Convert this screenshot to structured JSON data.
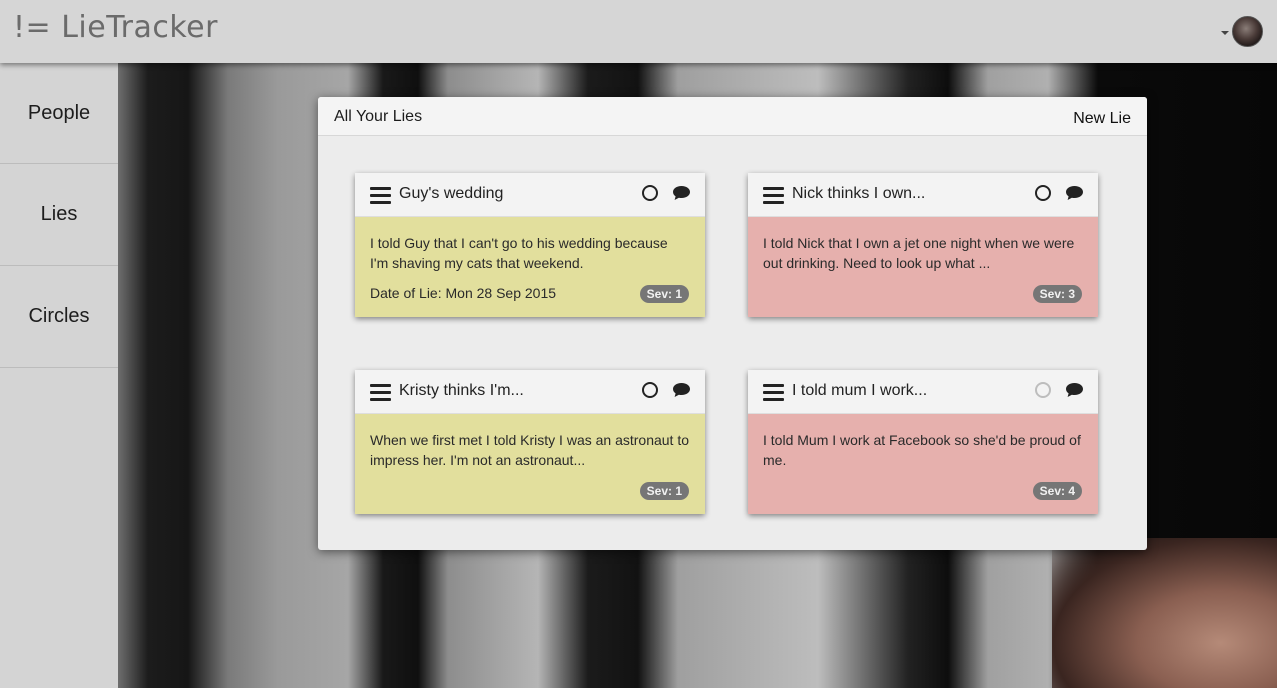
{
  "app": {
    "brand": "!= LieTracker"
  },
  "sidebar": {
    "items": [
      {
        "label": "People"
      },
      {
        "label": "Lies"
      },
      {
        "label": "Circles"
      }
    ]
  },
  "panel": {
    "title": "All Your Lies",
    "new_lie_label": "New Lie"
  },
  "cards": [
    {
      "title": "Guy's wedding",
      "text": "I told Guy that I can't go to his wedding because I'm shaving my cats that weekend.",
      "date": "Date of Lie: Mon 28 Sep 2015",
      "severity": "Sev: 1",
      "color": "#e2df9d"
    },
    {
      "title": "Nick thinks I own...",
      "text": "I told Nick that I own a jet one night when we were out drinking. Need to look up what ...",
      "severity": "Sev: 3",
      "color": "#e6b0ad"
    },
    {
      "title": "Kristy thinks I'm...",
      "text": "When we first met I told Kristy I was an astronaut to impress her. I'm not an astronaut...",
      "severity": "Sev: 1",
      "color": "#e2df9d"
    },
    {
      "title": "I told mum I work...",
      "text": "I told Mum I work at Facebook so she'd be proud of me.",
      "severity": "Sev: 4",
      "color": "#e6b0ad"
    }
  ],
  "icons": {
    "menu": "hamburger-icon",
    "status": "circle-icon",
    "comment": "speech-bubble-icon",
    "user_menu": "caret-down-icon"
  }
}
